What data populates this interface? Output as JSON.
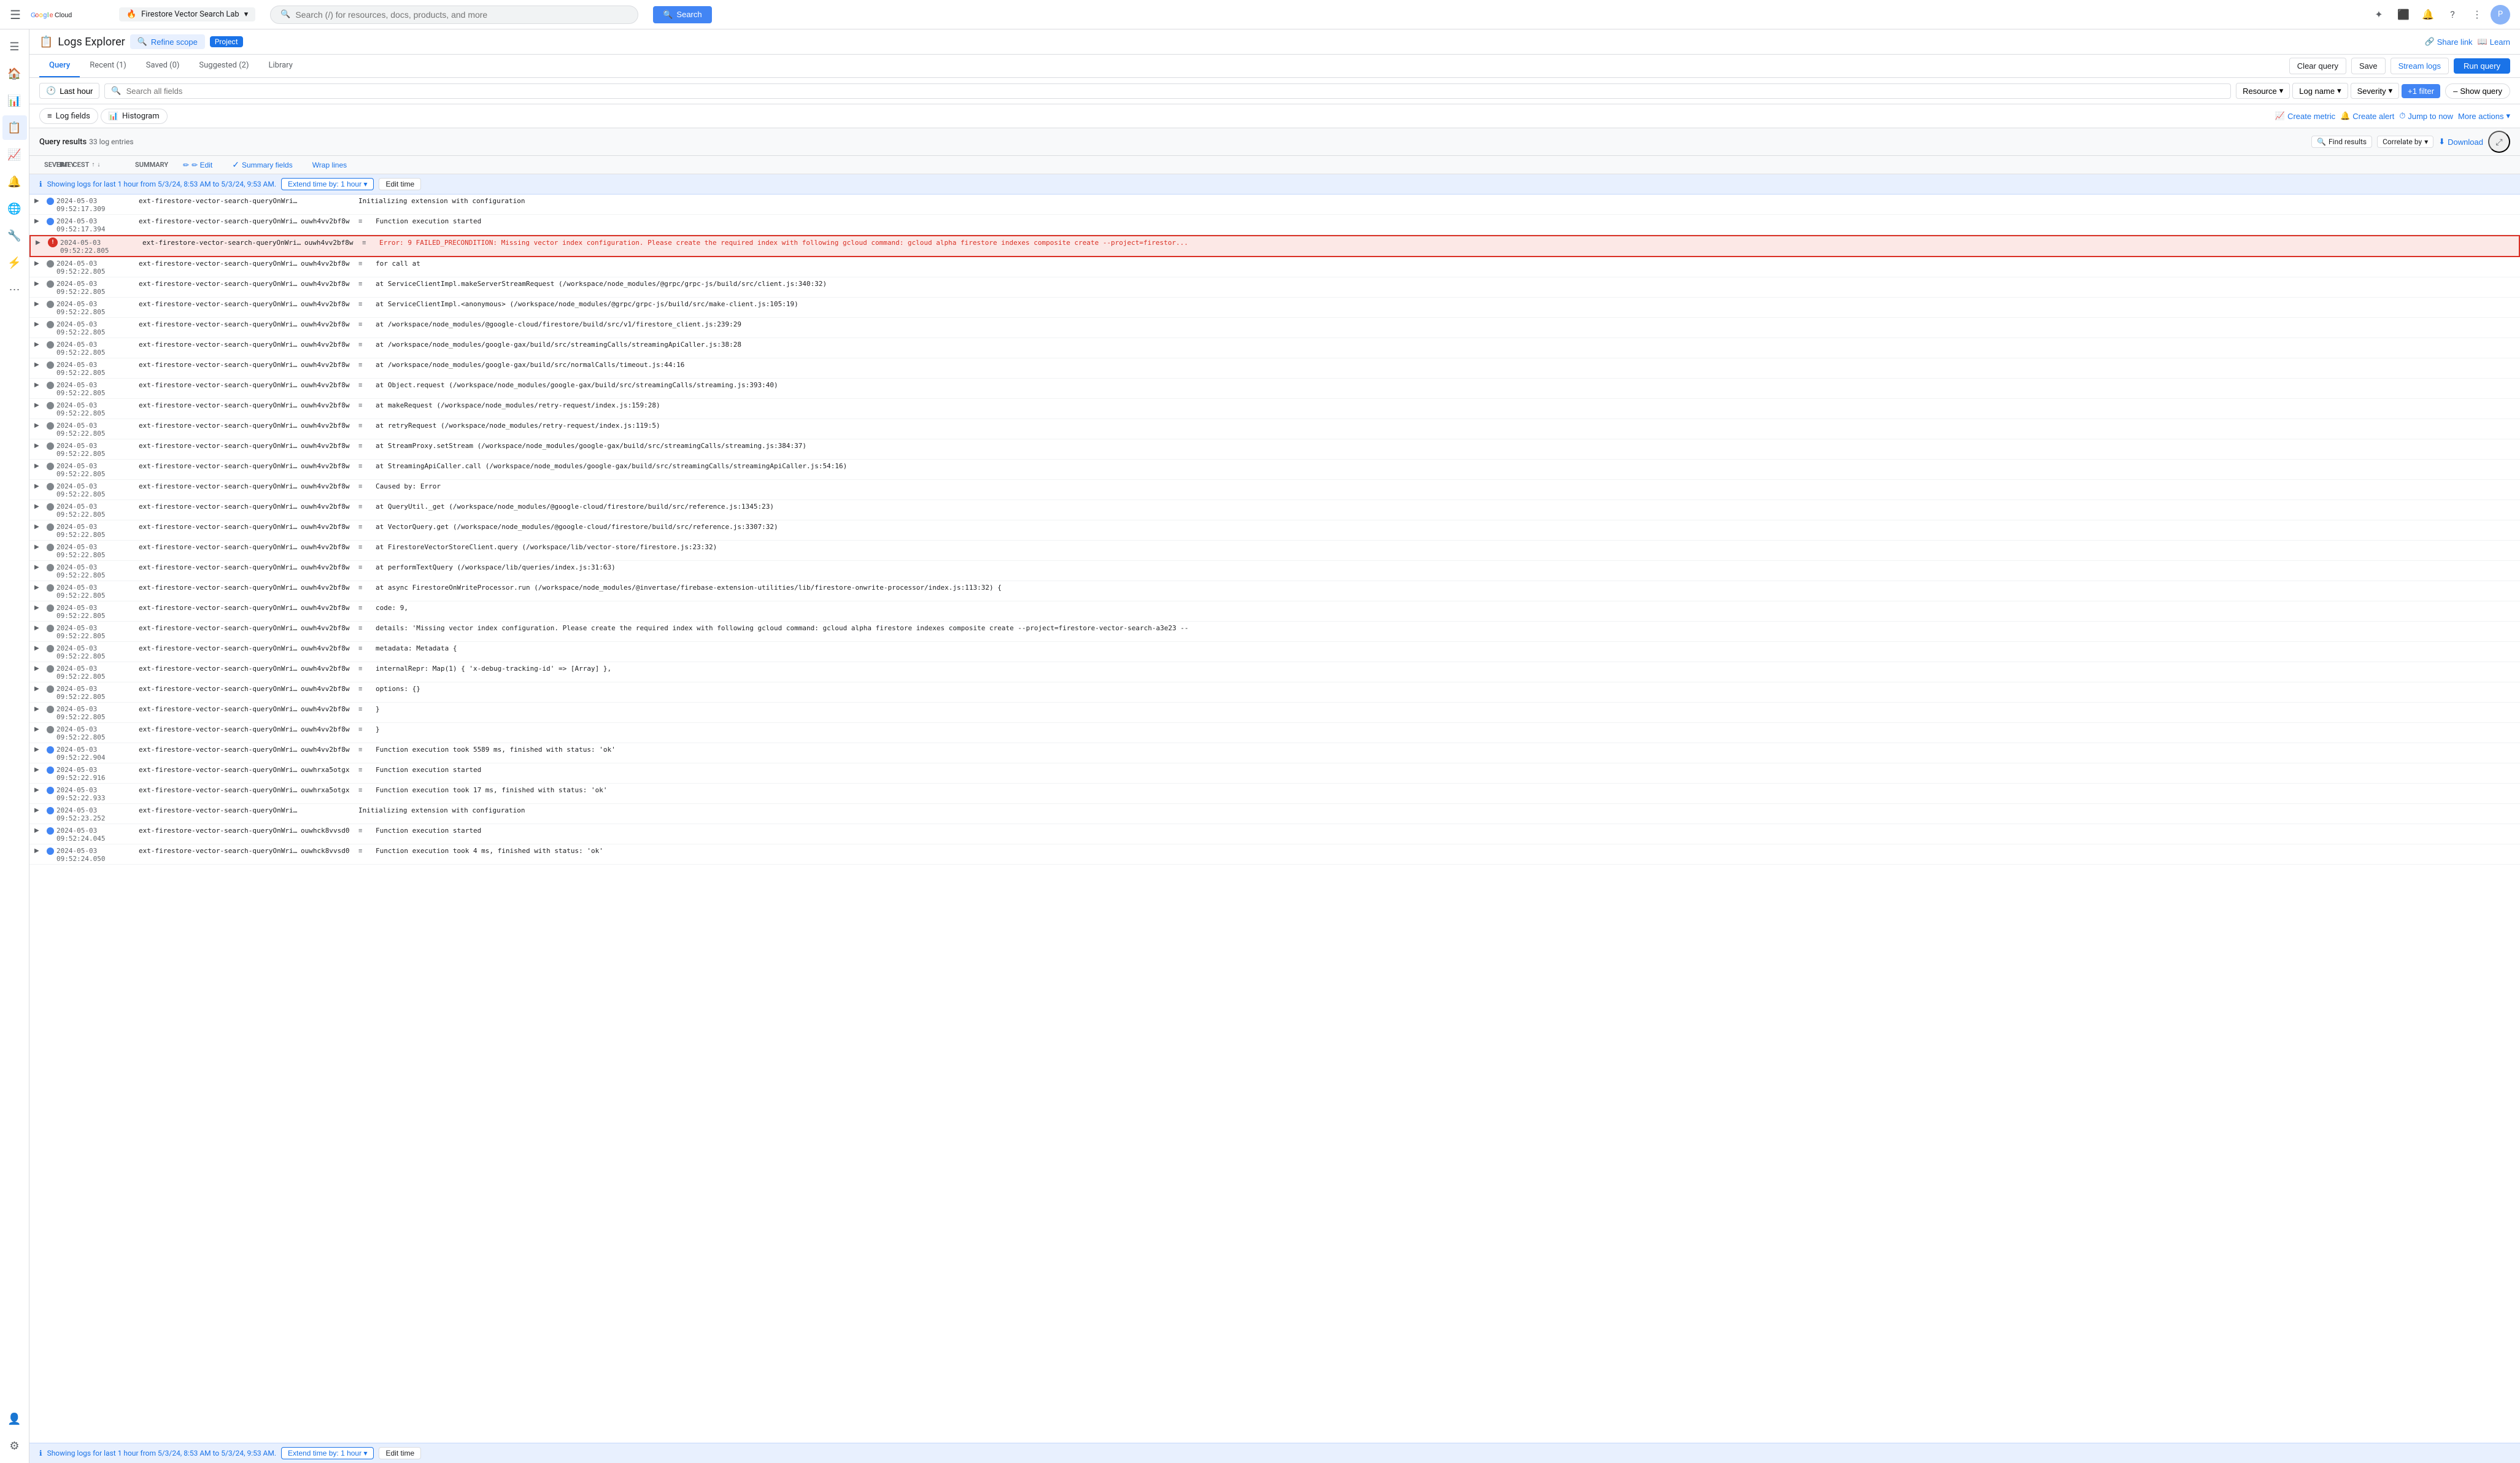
{
  "topbar": {
    "menu_icon": "☰",
    "logo_text_1": "Google",
    "logo_text_2": "Cloud",
    "project_name": "Firestore Vector Search Lab",
    "search_placeholder": "Search (/) for resources, docs, products, and more",
    "search_btn_label": "Search",
    "icons": [
      "✦",
      "⬛",
      "🔔",
      "?",
      "⋮"
    ]
  },
  "sidebar": {
    "icons": [
      "☰",
      "🏠",
      "📊",
      "📋",
      "📈",
      "🔔",
      "🌐",
      "🔧",
      "⚙",
      "👤"
    ]
  },
  "header": {
    "title": "Logs Explorer",
    "refine_scope_label": "Refine scope",
    "project_label": "Project",
    "share_link_label": "Share link",
    "learn_label": "Learn"
  },
  "tabs": {
    "items": [
      {
        "label": "Query",
        "active": true
      },
      {
        "label": "Recent (1)",
        "active": false
      },
      {
        "label": "Saved (0)",
        "active": false
      },
      {
        "label": "Suggested (2)",
        "active": false
      },
      {
        "label": "Library",
        "active": false
      }
    ],
    "clear_query": "Clear query",
    "save": "Save",
    "stream_logs": "Stream logs",
    "run_query": "Run query"
  },
  "query_toolbar": {
    "time_filter": "Last hour",
    "search_placeholder": "Search all fields",
    "resource_label": "Resource",
    "log_name_label": "Log name",
    "severity_label": "Severity",
    "plus_filter_label": "+1 filter",
    "show_query_label": "Show query"
  },
  "view_toggle": {
    "log_fields_label": "Log fields",
    "histogram_label": "Histogram",
    "create_metric_label": "Create metric",
    "create_alert_label": "Create alert",
    "jump_to_now_label": "Jump to now",
    "more_actions_label": "More actions"
  },
  "results_bar": {
    "title": "Query results",
    "count": "33 log entries",
    "find_results_label": "Find results",
    "correlate_by_label": "Correlate by",
    "download_label": "Download",
    "expand_icon": "⤢"
  },
  "col_headers": {
    "severity": "SEVERITY",
    "time": "TIME CEST",
    "summary": "SUMMARY",
    "edit_label": "✏ Edit",
    "summary_fields_label": "Summary fields",
    "wrap_lines_label": "Wrap lines"
  },
  "info_banner": {
    "text": "Showing logs for last 1 hour from 5/3/24, 8:53 AM to 5/3/24, 9:53 AM.",
    "extend_btn": "Extend time by: 1 hour",
    "edit_time_btn": "Edit time"
  },
  "log_entries": [
    {
      "expand": "▶",
      "severity_type": "info",
      "time": "2024-05-03 09:52:17.309",
      "service": "ext-firestore-vector-search-queryOnWrite",
      "instance": "",
      "icon": "",
      "message": "Initializing extension with configuration"
    },
    {
      "expand": "▶",
      "severity_type": "info",
      "time": "2024-05-03 09:52:17.394",
      "service": "ext-firestore-vector-search-queryOnWrite",
      "instance": "ouwh4vv2bf8w",
      "icon": "≡",
      "message": "Function execution started"
    },
    {
      "expand": "▶",
      "severity_type": "error",
      "time": "2024-05-03 09:52:22.805",
      "service": "ext-firestore-vector-search-queryOnWrite",
      "instance": "ouwh4vv2bf8w",
      "icon": "≡",
      "message": "Error: 9 FAILED_PRECONDITION: Missing vector index configuration. Please create the required index with following gcloud command: gcloud alpha firestore indexes composite create --project=firestor...",
      "is_error_highlight": true,
      "error_badge": true
    },
    {
      "expand": "▶",
      "severity_type": "debug",
      "time": "2024-05-03 09:52:22.805",
      "service": "ext-firestore-vector-search-queryOnWrite",
      "instance": "ouwh4vv2bf8w",
      "icon": "≡",
      "message": "for call at"
    },
    {
      "expand": "▶",
      "severity_type": "debug",
      "time": "2024-05-03 09:52:22.805",
      "service": "ext-firestore-vector-search-queryOnWrite",
      "instance": "ouwh4vv2bf8w",
      "icon": "≡",
      "message": "    at ServiceClientImpl.makeServerStreamRequest (/workspace/node_modules/@grpc/grpc-js/build/src/client.js:340:32)"
    },
    {
      "expand": "▶",
      "severity_type": "debug",
      "time": "2024-05-03 09:52:22.805",
      "service": "ext-firestore-vector-search-queryOnWrite",
      "instance": "ouwh4vv2bf8w",
      "icon": "≡",
      "message": "    at ServiceClientImpl.<anonymous> (/workspace/node_modules/@grpc/grpc-js/build/src/make-client.js:105:19)"
    },
    {
      "expand": "▶",
      "severity_type": "debug",
      "time": "2024-05-03 09:52:22.805",
      "service": "ext-firestore-vector-search-queryOnWrite",
      "instance": "ouwh4vv2bf8w",
      "icon": "≡",
      "message": "    at /workspace/node_modules/@google-cloud/firestore/build/src/v1/firestore_client.js:239:29"
    },
    {
      "expand": "▶",
      "severity_type": "debug",
      "time": "2024-05-03 09:52:22.805",
      "service": "ext-firestore-vector-search-queryOnWrite",
      "instance": "ouwh4vv2bf8w",
      "icon": "≡",
      "message": "    at /workspace/node_modules/google-gax/build/src/streamingCalls/streamingApiCaller.js:38:28"
    },
    {
      "expand": "▶",
      "severity_type": "debug",
      "time": "2024-05-03 09:52:22.805",
      "service": "ext-firestore-vector-search-queryOnWrite",
      "instance": "ouwh4vv2bf8w",
      "icon": "≡",
      "message": "    at /workspace/node_modules/google-gax/build/src/normalCalls/timeout.js:44:16"
    },
    {
      "expand": "▶",
      "severity_type": "debug",
      "time": "2024-05-03 09:52:22.805",
      "service": "ext-firestore-vector-search-queryOnWrite",
      "instance": "ouwh4vv2bf8w",
      "icon": "≡",
      "message": "    at Object.request (/workspace/node_modules/google-gax/build/src/streamingCalls/streaming.js:393:40)"
    },
    {
      "expand": "▶",
      "severity_type": "debug",
      "time": "2024-05-03 09:52:22.805",
      "service": "ext-firestore-vector-search-queryOnWrite",
      "instance": "ouwh4vv2bf8w",
      "icon": "≡",
      "message": "    at makeRequest (/workspace/node_modules/retry-request/index.js:159:28)"
    },
    {
      "expand": "▶",
      "severity_type": "debug",
      "time": "2024-05-03 09:52:22.805",
      "service": "ext-firestore-vector-search-queryOnWrite",
      "instance": "ouwh4vv2bf8w",
      "icon": "≡",
      "message": "    at retryRequest (/workspace/node_modules/retry-request/index.js:119:5)"
    },
    {
      "expand": "▶",
      "severity_type": "debug",
      "time": "2024-05-03 09:52:22.805",
      "service": "ext-firestore-vector-search-queryOnWrite",
      "instance": "ouwh4vv2bf8w",
      "icon": "≡",
      "message": "    at StreamProxy.setStream (/workspace/node_modules/google-gax/build/src/streamingCalls/streaming.js:384:37)"
    },
    {
      "expand": "▶",
      "severity_type": "debug",
      "time": "2024-05-03 09:52:22.805",
      "service": "ext-firestore-vector-search-queryOnWrite",
      "instance": "ouwh4vv2bf8w",
      "icon": "≡",
      "message": "    at StreamingApiCaller.call (/workspace/node_modules/google-gax/build/src/streamingCalls/streamingApiCaller.js:54:16)"
    },
    {
      "expand": "▶",
      "severity_type": "debug",
      "time": "2024-05-03 09:52:22.805",
      "service": "ext-firestore-vector-search-queryOnWrite",
      "instance": "ouwh4vv2bf8w",
      "icon": "≡",
      "message": "Caused by: Error"
    },
    {
      "expand": "▶",
      "severity_type": "debug",
      "time": "2024-05-03 09:52:22.805",
      "service": "ext-firestore-vector-search-queryOnWrite",
      "instance": "ouwh4vv2bf8w",
      "icon": "≡",
      "message": "    at QueryUtil._get (/workspace/node_modules/@google-cloud/firestore/build/src/reference.js:1345:23)"
    },
    {
      "expand": "▶",
      "severity_type": "debug",
      "time": "2024-05-03 09:52:22.805",
      "service": "ext-firestore-vector-search-queryOnWrite",
      "instance": "ouwh4vv2bf8w",
      "icon": "≡",
      "message": "    at VectorQuery.get (/workspace/node_modules/@google-cloud/firestore/build/src/reference.js:3307:32)"
    },
    {
      "expand": "▶",
      "severity_type": "debug",
      "time": "2024-05-03 09:52:22.805",
      "service": "ext-firestore-vector-search-queryOnWrite",
      "instance": "ouwh4vv2bf8w",
      "icon": "≡",
      "message": "    at FirestoreVectorStoreClient.query (/workspace/lib/vector-store/firestore.js:23:32)"
    },
    {
      "expand": "▶",
      "severity_type": "debug",
      "time": "2024-05-03 09:52:22.805",
      "service": "ext-firestore-vector-search-queryOnWrite",
      "instance": "ouwh4vv2bf8w",
      "icon": "≡",
      "message": "    at performTextQuery (/workspace/lib/queries/index.js:31:63)"
    },
    {
      "expand": "▶",
      "severity_type": "debug",
      "time": "2024-05-03 09:52:22.805",
      "service": "ext-firestore-vector-search-queryOnWrite",
      "instance": "ouwh4vv2bf8w",
      "icon": "≡",
      "message": "    at async FirestoreOnWriteProcessor.run (/workspace/node_modules/@invertase/firebase-extension-utilities/lib/firestore-onwrite-processor/index.js:113:32) {"
    },
    {
      "expand": "▶",
      "severity_type": "debug",
      "time": "2024-05-03 09:52:22.805",
      "service": "ext-firestore-vector-search-queryOnWrite",
      "instance": "ouwh4vv2bf8w",
      "icon": "≡",
      "message": "  code: 9,"
    },
    {
      "expand": "▶",
      "severity_type": "debug",
      "time": "2024-05-03 09:52:22.805",
      "service": "ext-firestore-vector-search-queryOnWrite",
      "instance": "ouwh4vv2bf8w",
      "icon": "≡",
      "message": "  details: 'Missing vector index configuration. Please create the required index with following gcloud command: gcloud alpha firestore indexes composite create --project=firestore-vector-search-a3e23 --"
    },
    {
      "expand": "▶",
      "severity_type": "debug",
      "time": "2024-05-03 09:52:22.805",
      "service": "ext-firestore-vector-search-queryOnWrite",
      "instance": "ouwh4vv2bf8w",
      "icon": "≡",
      "message": "  metadata: Metadata {"
    },
    {
      "expand": "▶",
      "severity_type": "debug",
      "time": "2024-05-03 09:52:22.805",
      "service": "ext-firestore-vector-search-queryOnWrite",
      "instance": "ouwh4vv2bf8w",
      "icon": "≡",
      "message": "    internalRepr: Map(1) { 'x-debug-tracking-id' => [Array] },"
    },
    {
      "expand": "▶",
      "severity_type": "debug",
      "time": "2024-05-03 09:52:22.805",
      "service": "ext-firestore-vector-search-queryOnWrite",
      "instance": "ouwh4vv2bf8w",
      "icon": "≡",
      "message": "    options: {}"
    },
    {
      "expand": "▶",
      "severity_type": "debug",
      "time": "2024-05-03 09:52:22.805",
      "service": "ext-firestore-vector-search-queryOnWrite",
      "instance": "ouwh4vv2bf8w",
      "icon": "≡",
      "message": "  }"
    },
    {
      "expand": "▶",
      "severity_type": "debug",
      "time": "2024-05-03 09:52:22.805",
      "service": "ext-firestore-vector-search-queryOnWrite",
      "instance": "ouwh4vv2bf8w",
      "icon": "≡",
      "message": "}"
    },
    {
      "expand": "▶",
      "severity_type": "info",
      "time": "2024-05-03 09:52:22.904",
      "service": "ext-firestore-vector-search-queryOnWrite",
      "instance": "ouwh4vv2bf8w",
      "icon": "≡",
      "message": "Function execution took 5589 ms, finished with status: 'ok'"
    },
    {
      "expand": "▶",
      "severity_type": "info",
      "time": "2024-05-03 09:52:22.916",
      "service": "ext-firestore-vector-search-queryOnWrite",
      "instance": "ouwhrxa5otgx",
      "icon": "≡",
      "message": "Function execution started"
    },
    {
      "expand": "▶",
      "severity_type": "info",
      "time": "2024-05-03 09:52:22.933",
      "service": "ext-firestore-vector-search-queryOnWrite",
      "instance": "ouwhrxa5otgx",
      "icon": "≡",
      "message": "Function execution took 17 ms, finished with status: 'ok'"
    },
    {
      "expand": "▶",
      "severity_type": "info",
      "time": "2024-05-03 09:52:23.252",
      "service": "ext-firestore-vector-search-queryOnWrite",
      "instance": "",
      "icon": "",
      "message": "Initializing extension with configuration"
    },
    {
      "expand": "▶",
      "severity_type": "info",
      "time": "2024-05-03 09:52:24.045",
      "service": "ext-firestore-vector-search-queryOnWrite",
      "instance": "ouwhck8vvsd0",
      "icon": "≡",
      "message": "Function execution started"
    },
    {
      "expand": "▶",
      "severity_type": "info",
      "time": "2024-05-03 09:52:24.050",
      "service": "ext-firestore-vector-search-queryOnWrite",
      "instance": "ouwhck8vvsd0",
      "icon": "≡",
      "message": "Function execution took 4 ms, finished with status: 'ok'"
    }
  ],
  "bottom_banner": {
    "text": "Showing logs for last 1 hour from 5/3/24, 8:53 AM to 5/3/24, 9:53 AM.",
    "extend_btn": "Extend time by: 1 hour",
    "edit_time_btn": "Edit time"
  }
}
